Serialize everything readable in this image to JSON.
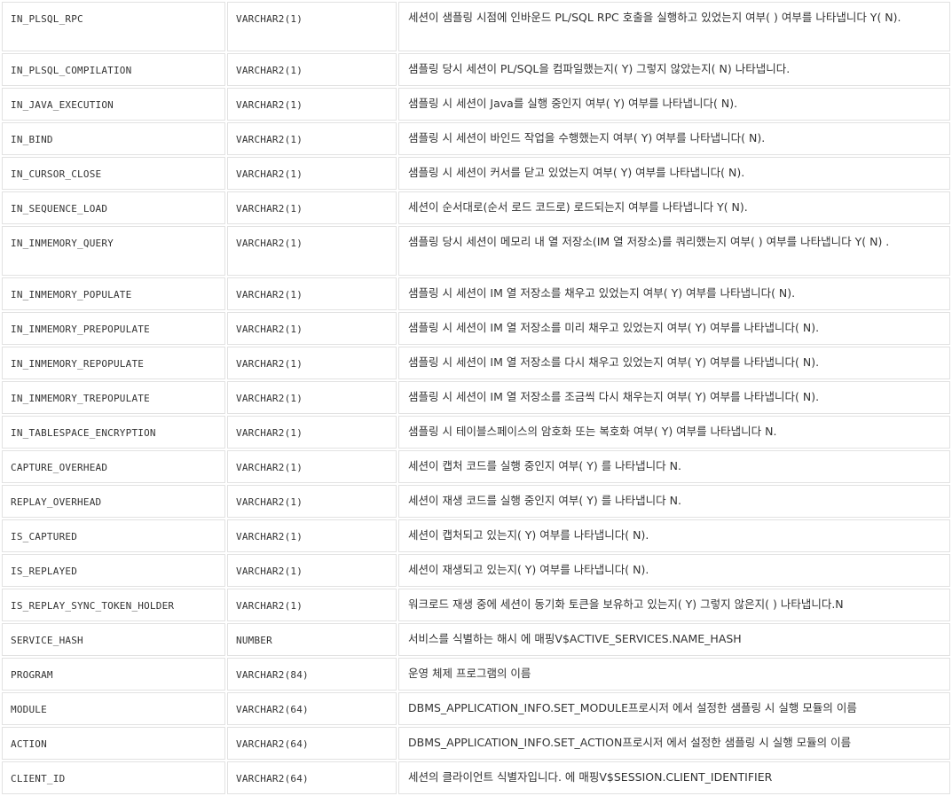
{
  "rows": [
    {
      "name": "IN_PLSQL_RPC",
      "type": "VARCHAR2(1)",
      "desc": "세션이 샘플링 시점에 인바운드 PL/SQL RPC 호출을 실행하고 있었는지 여부( ) 여부를 나타냅니다 Y( N)."
    },
    {
      "name": "IN_PLSQL_COMPILATION",
      "type": "VARCHAR2(1)",
      "desc": "샘플링 당시 세션이 PL/SQL을 컴파일했는지( Y) 그렇지 않았는지( N) 나타냅니다."
    },
    {
      "name": "IN_JAVA_EXECUTION",
      "type": "VARCHAR2(1)",
      "desc": "샘플링 시 세션이 Java를 실행 중인지 여부( Y) 여부를 나타냅니다( N)."
    },
    {
      "name": "IN_BIND",
      "type": "VARCHAR2(1)",
      "desc": "샘플링 시 세션이 바인드 작업을 수행했는지 여부( Y) 여부를 나타냅니다( N)."
    },
    {
      "name": "IN_CURSOR_CLOSE",
      "type": "VARCHAR2(1)",
      "desc": "샘플링 시 세션이 커서를 닫고 있었는지 여부( Y) 여부를 나타냅니다( N)."
    },
    {
      "name": "IN_SEQUENCE_LOAD",
      "type": "VARCHAR2(1)",
      "desc": "세션이 순서대로(순서 로드 코드로) 로드되는지 여부를 나타냅니다 Y( N)."
    },
    {
      "name": "IN_INMEMORY_QUERY",
      "type": "VARCHAR2(1)",
      "desc": "샘플링 당시 세션이 메모리 내 열 저장소(IM 열 저장소)를 쿼리했는지 여부( ) 여부를 나타냅니다 Y( N) ."
    },
    {
      "name": "IN_INMEMORY_POPULATE",
      "type": "VARCHAR2(1)",
      "desc": "샘플링 시 세션이 IM 열 저장소를 채우고 있었는지 여부( Y) 여부를 나타냅니다( N)."
    },
    {
      "name": "IN_INMEMORY_PREPOPULATE",
      "type": "VARCHAR2(1)",
      "desc": "샘플링 시 세션이 IM 열 저장소를 미리 채우고 있었는지 여부( Y) 여부를 나타냅니다( N)."
    },
    {
      "name": "IN_INMEMORY_REPOPULATE",
      "type": "VARCHAR2(1)",
      "desc": "샘플링 시 세션이 IM 열 저장소를 다시 채우고 있었는지 여부( Y) 여부를 나타냅니다( N)."
    },
    {
      "name": "IN_INMEMORY_TREPOPULATE",
      "type": "VARCHAR2(1)",
      "desc": "샘플링 시 세션이 IM 열 저장소를 조금씩 다시 채우는지 여부( Y) 여부를 나타냅니다( N)."
    },
    {
      "name": "IN_TABLESPACE_ENCRYPTION",
      "type": "VARCHAR2(1)",
      "desc": "샘플링 시 테이블스페이스의 암호화 또는 복호화 여부( Y) 여부를 나타냅니다 N."
    },
    {
      "name": "CAPTURE_OVERHEAD",
      "type": "VARCHAR2(1)",
      "desc": "세션이 캡처 코드를 실행 중인지 여부( Y) 를 나타냅니다 N."
    },
    {
      "name": "REPLAY_OVERHEAD",
      "type": "VARCHAR2(1)",
      "desc": "세션이 재생 코드를 실행 중인지 여부( Y) 를 나타냅니다 N."
    },
    {
      "name": "IS_CAPTURED",
      "type": "VARCHAR2(1)",
      "desc": "세션이 캡처되고 있는지( Y) 여부를 나타냅니다( N)."
    },
    {
      "name": "IS_REPLAYED",
      "type": "VARCHAR2(1)",
      "desc": "세션이 재생되고 있는지( Y) 여부를 나타냅니다( N)."
    },
    {
      "name": "IS_REPLAY_SYNC_TOKEN_HOLDER",
      "type": "VARCHAR2(1)",
      "desc": "워크로드 재생 중에 세션이 동기화 토큰을 보유하고 있는지( Y) 그렇지 않은지( ) 나타냅니다.N"
    },
    {
      "name": "SERVICE_HASH",
      "type": "NUMBER",
      "desc": "서비스를 식별하는 해시 에 매핑V$ACTIVE_SERVICES.NAME_HASH"
    },
    {
      "name": "PROGRAM",
      "type": "VARCHAR2(84)",
      "desc": "운영 체제 프로그램의 이름"
    },
    {
      "name": "MODULE",
      "type": "VARCHAR2(64)",
      "desc": "DBMS_APPLICATION_INFO.SET_MODULE프로시저 에서 설정한 샘플링 시 실행 모듈의 이름"
    },
    {
      "name": "ACTION",
      "type": "VARCHAR2(64)",
      "desc": "DBMS_APPLICATION_INFO.SET_ACTION프로시저 에서 설정한 샘플링 시 실행 모듈의 이름"
    },
    {
      "name": "CLIENT_ID",
      "type": "VARCHAR2(64)",
      "desc": "세션의 클라이언트 식별자입니다. 에 매핑V$SESSION.CLIENT_IDENTIFIER"
    }
  ]
}
